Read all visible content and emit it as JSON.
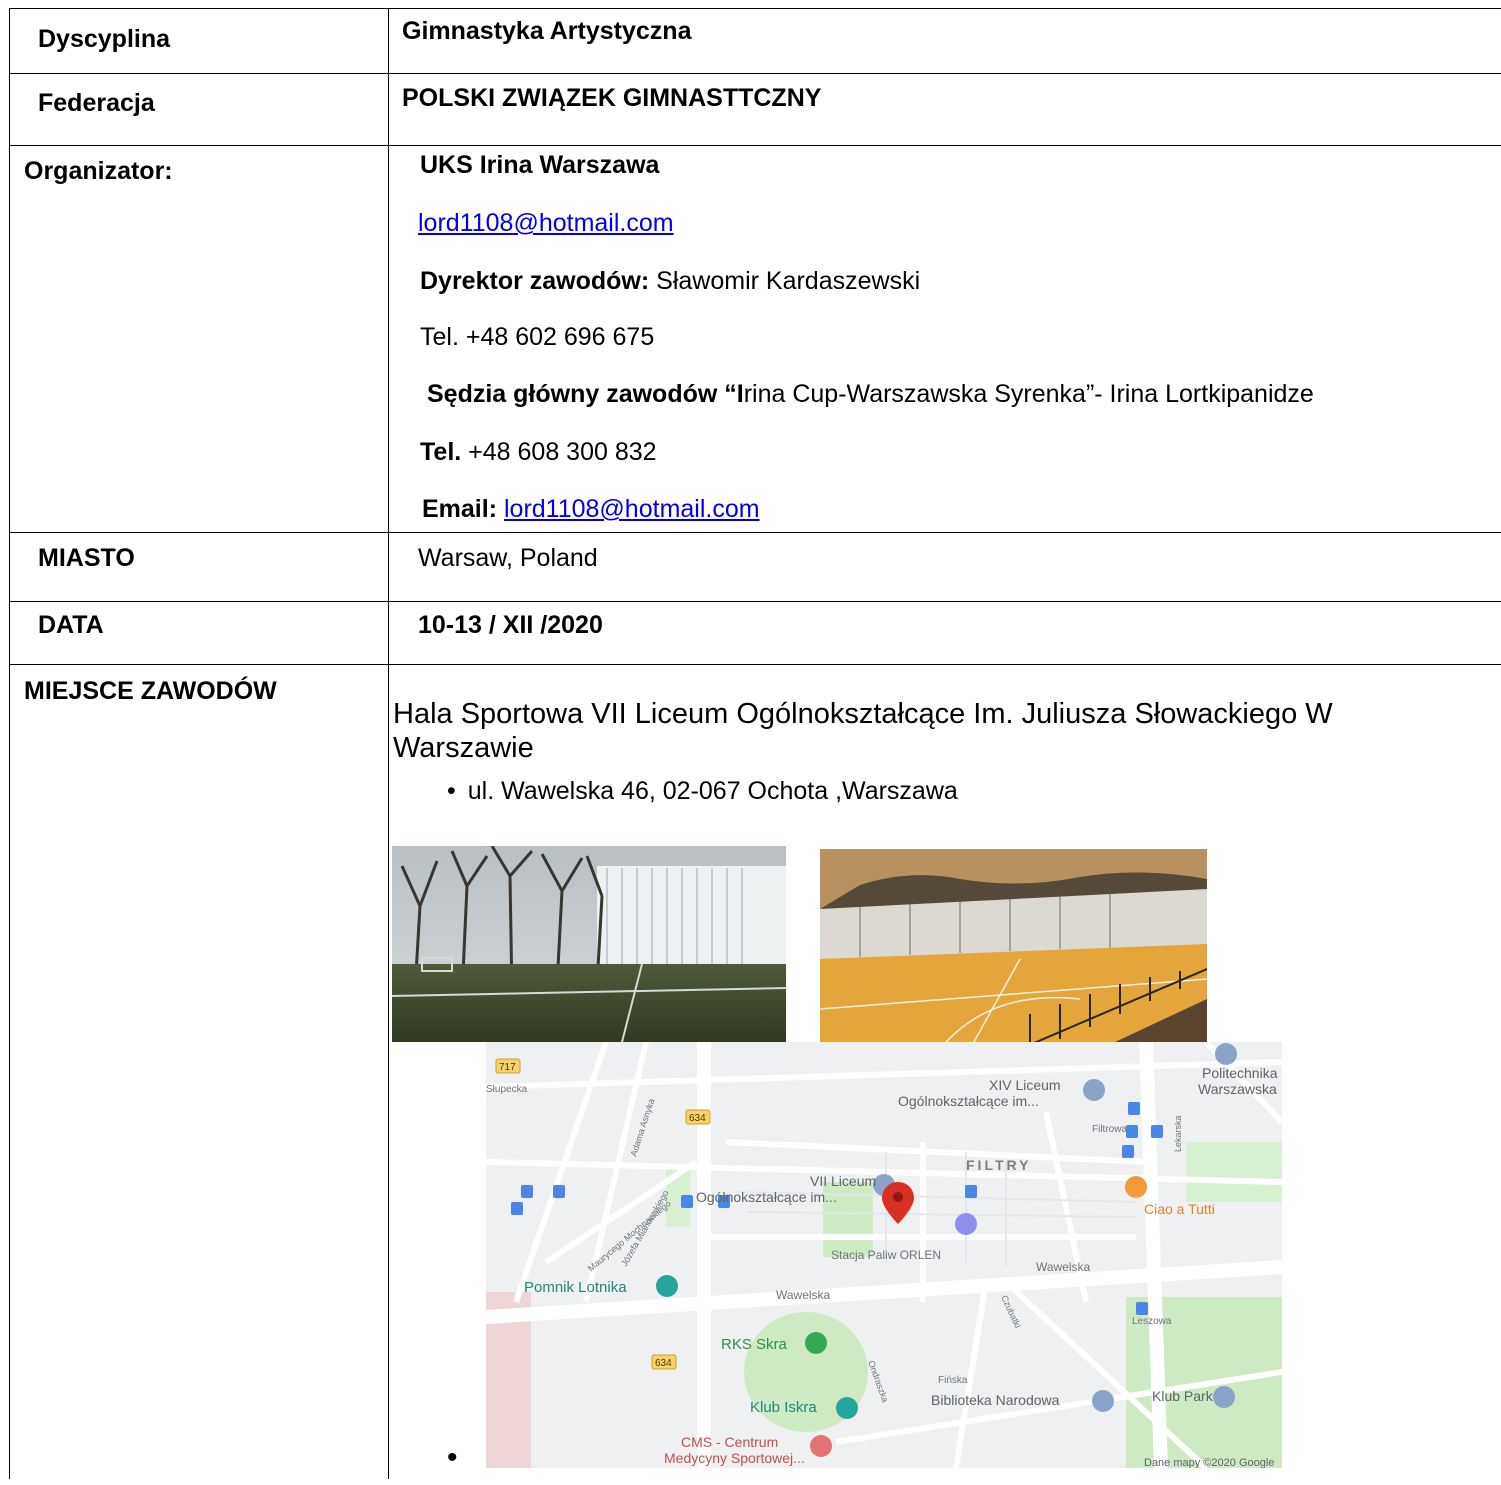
{
  "rows": {
    "dyscyplina": {
      "label": "Dyscyplina",
      "value": "Gimnastyka Artystyczna"
    },
    "federacja": {
      "label": "Federacja",
      "value": "POLSKI ZWIĄZEK GIMNASTTCZNY"
    },
    "organizator": {
      "label": "Organizator:",
      "name": "UKS Irina Warszawa",
      "email": "lord1108@hotmail.com",
      "director_label": "Dyrektor zawodów:",
      "director_name": "Sławomir Kardaszewski",
      "director_tel": "Tel. +48 602 696 675",
      "judge_label": "Sędzia główny zawodów “I",
      "judge_rest": "rina Cup-Warszawska Syrenka”- Irina Lortkipanidze",
      "judge_tel_label": "Tel.",
      "judge_tel": "+48 608 300 832",
      "email_label": "Email:",
      "email2": "lord1108@hotmail.com"
    },
    "miasto": {
      "label": "MIASTO",
      "value": "Warsaw, Poland"
    },
    "data": {
      "label": "DATA",
      "value": "10-13 / XII /2020"
    },
    "miejsce": {
      "label": "MIEJSCE ZAWODÓW",
      "venue": "Hala Sportowa VII Liceum Ogólnokształcące Im. Juliusza Słowackiego W Warszawie",
      "address": "ul. Wawelska 46, 02-067 Ochota ,Warszawa",
      "bullet": "•"
    }
  },
  "map": {
    "road_badges": [
      "717",
      "634",
      "634"
    ],
    "labels": {
      "politechnika": "Politechnika Warszawska",
      "xiv_liceum_1": "XIV Liceum",
      "xiv_liceum_2": "Ogólnokształcące im...",
      "filtry": "FILTRY",
      "filtrowa": "Filtrowa",
      "lekarska": "Lekarska",
      "vii_liceum_1": "VII Liceum",
      "vii_liceum_2": "Ogólnokształcące im...",
      "ciao": "Ciao a Tutti",
      "wawelska_1": "Wawelska",
      "wawelska_2": "Wawelska",
      "pomnik": "Pomnik Lotnika",
      "stacja": "Stacja Paliw ORLEN",
      "slupecka": "Słupecka",
      "asnyka": "Adama Asnyka",
      "mochnackiego": "Maurycego Mochnackiego",
      "mianowskiego": "Józefa Mianowskiego",
      "rks": "RKS Skra",
      "klub_iskra": "Klub Iskra",
      "biblioteka": "Biblioteka Narodowa",
      "klub_park": "Klub Park",
      "leszowa": "Leszowa",
      "finska": "Fińska",
      "ondraszka": "Ondraszka",
      "czubatki": "Czubatki",
      "cms_1": "CMS - Centrum",
      "cms_2": "Medycyny Sportowej...",
      "credit": "Dane mapy ©2020 Google"
    },
    "colors": {
      "green_poi": "#34a853",
      "blue_poi": "#5e8ed6",
      "marker": "#d93025",
      "orange_poi": "#f29a38",
      "purple_poi": "#8e8ef0"
    }
  }
}
